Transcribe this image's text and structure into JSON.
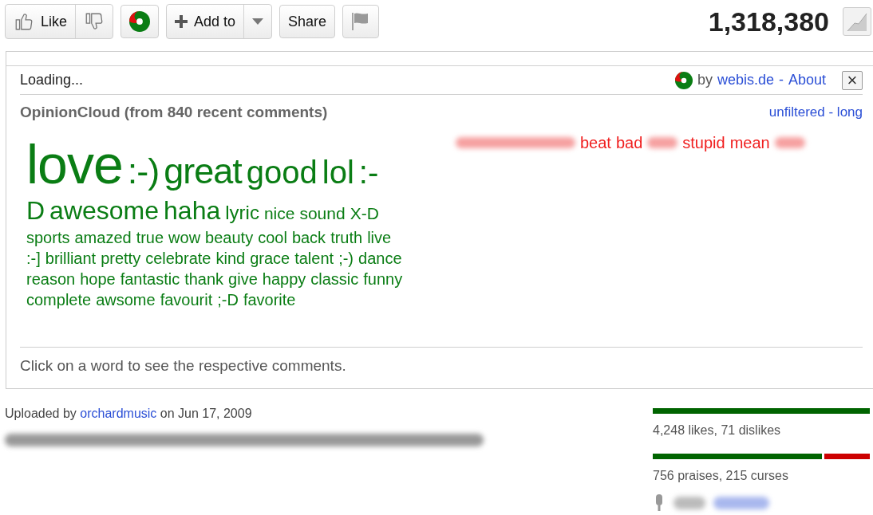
{
  "toolbar": {
    "like": "Like",
    "add_to": "Add to",
    "share": "Share",
    "view_count": "1,318,380"
  },
  "opinion_cloud": {
    "status": "Loading...",
    "by": "by",
    "site_link": "webis.de",
    "separator": "-",
    "about_link": "About",
    "close": "×",
    "title": "OpinionCloud (from 840 recent comments)",
    "filter_links": "unfiltered - long",
    "positive_lines": [
      [
        {
          "word": "love",
          "kind": "huge"
        },
        {
          "word": ":-)",
          "kind": "xlarge"
        },
        {
          "word": "great",
          "kind": "xlarge"
        },
        {
          "word": "good",
          "kind": "large"
        },
        {
          "word": "lol",
          "kind": "large"
        },
        {
          "word": ":-",
          "kind": "large"
        }
      ],
      [
        {
          "word": "D",
          "kind": "medium"
        },
        {
          "word": "awesome",
          "kind": "medium"
        },
        {
          "word": "haha",
          "kind": "medium"
        },
        {
          "word": "lyric",
          "kind": "small"
        },
        {
          "word": "nice",
          "kind": "xsmall"
        },
        {
          "word": "sound",
          "kind": "xsmall"
        },
        {
          "word": "X-D",
          "kind": "xsmall"
        }
      ],
      [
        {
          "word": "sports",
          "kind": "tiny"
        },
        {
          "word": "amazed",
          "kind": "tiny"
        },
        {
          "word": "true",
          "kind": "tiny"
        },
        {
          "word": "wow",
          "kind": "tiny"
        },
        {
          "word": "beauty",
          "kind": "tiny"
        },
        {
          "word": "cool",
          "kind": "tiny"
        },
        {
          "word": "back",
          "kind": "tiny"
        },
        {
          "word": "truth",
          "kind": "tiny"
        },
        {
          "word": "live",
          "kind": "tiny"
        }
      ],
      [
        {
          "word": ":-]",
          "kind": "tiny"
        },
        {
          "word": "brilliant",
          "kind": "tiny"
        },
        {
          "word": "pretty",
          "kind": "tiny"
        },
        {
          "word": "celebrate",
          "kind": "tiny"
        },
        {
          "word": "kind",
          "kind": "tiny"
        },
        {
          "word": "grace",
          "kind": "tiny"
        },
        {
          "word": "talent",
          "kind": "tiny"
        },
        {
          "word": ";-)",
          "kind": "tiny"
        },
        {
          "word": "dance",
          "kind": "tiny"
        }
      ],
      [
        {
          "word": "reason",
          "kind": "tiny"
        },
        {
          "word": "hope",
          "kind": "tiny"
        },
        {
          "word": "fantastic",
          "kind": "tiny"
        },
        {
          "word": "thank",
          "kind": "tiny"
        },
        {
          "word": "give",
          "kind": "tiny"
        },
        {
          "word": "happy",
          "kind": "tiny"
        },
        {
          "word": "classic",
          "kind": "tiny"
        },
        {
          "word": "funny",
          "kind": "tiny"
        }
      ],
      [
        {
          "word": "complete",
          "kind": "tiny"
        },
        {
          "word": "awsome",
          "kind": "tiny"
        },
        {
          "word": "favourit",
          "kind": "tiny"
        },
        {
          "word": ";-D",
          "kind": "tiny"
        },
        {
          "word": "favorite",
          "kind": "tiny"
        }
      ]
    ],
    "negative_words": [
      {
        "kind": "blurred"
      },
      {
        "word": "beat",
        "kind": "word"
      },
      {
        "word": "bad",
        "kind": "word"
      },
      {
        "kind": "blurred_short"
      },
      {
        "word": "stupid",
        "kind": "word"
      },
      {
        "word": "mean",
        "kind": "word"
      },
      {
        "kind": "blurred_short"
      }
    ],
    "hint": "Click on a word to see the respective comments."
  },
  "details": {
    "uploaded_prefix": "Uploaded by",
    "uploader": "orchardmusic",
    "uploaded_suffix": "on Jun 17, 2009"
  },
  "ratings": [
    {
      "level": 1.0,
      "label": "4,248 likes, 71 dislikes"
    },
    {
      "level": 0.78,
      "label": "756 praises, 215 curses"
    }
  ]
}
